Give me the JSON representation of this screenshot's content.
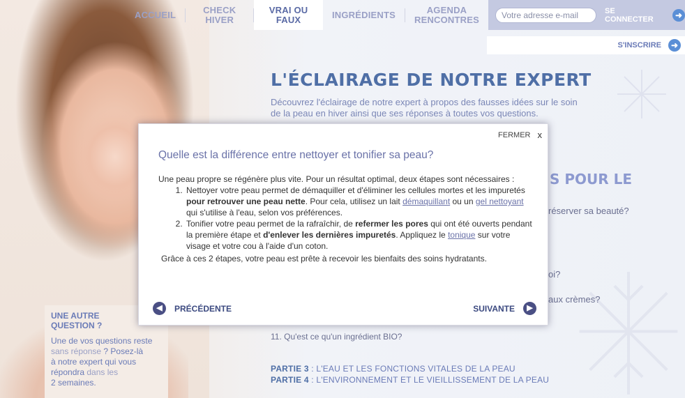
{
  "nav": {
    "items": [
      "ACCUEIL",
      "CHECK HIVER",
      "VRAI OU",
      "FAUX",
      "INGRÉDIENTS",
      "AGENDA",
      "RENCONTRES"
    ]
  },
  "login": {
    "email_placeholder": "Votre adresse e-mail",
    "connect_label": "SE CONNECTER",
    "register_label": "S'INSCRIRE"
  },
  "main": {
    "title": "L'ÉCLAIRAGE DE NOTRE EXPERT",
    "intro": "Découvrez l'éclairage de notre expert à propos des fausses idées sur le soin de la peau en hiver ainsi que ses réponses à toutes vos questions.",
    "bg_heading": "S POUR LE",
    "bg_q1": "réserver sa beauté?",
    "bg_q2": "oi?",
    "bg_q3": "aux crèmes?",
    "q11": "11.  Qu'est ce qu'un ingrédient BIO?",
    "part3_label": "PARTIE 3",
    "part3_text": " : L'EAU ET LES FONCTIONS VITALES DE LA PEAU",
    "part4_label": "PARTIE 4",
    "part4_text": " : L'ENVIRONNEMENT ET LE VIEILLISSEMENT DE LA PEAU"
  },
  "side": {
    "title_1": "UNE AUTRE",
    "title_2": "QUESTION ?",
    "t1": "Une de vos questions reste",
    "t2a": "sans réponse",
    "t2b": " ? Posez-là",
    "t3": "à notre expert qui vous",
    "t4a": "répondra",
    "t4b": " dans les",
    "t5": "2 semaines."
  },
  "modal": {
    "close_label": "FERMER",
    "close_x": "x",
    "question": "Quelle est la différence entre nettoyer et tonifier sa peau?",
    "intro": "Une peau propre se régénère plus vite. Pour un résultat optimal, deux étapes sont nécessaires :",
    "item1_a": "Nettoyer votre peau permet de démaquiller et d'éliminer les cellules mortes et les impuretés ",
    "item1_b": "pour retrouver une peau nette",
    "item1_c": ". Pour cela, utilisez un lait ",
    "item1_link1": "démaquillant",
    "item1_d": " ou un ",
    "item1_link2": "gel nettoyant",
    "item1_e": " qui s'utilise à l'eau, selon vos préférences.",
    "item2_a": "Tonifier votre peau permet de la rafraîchir, de ",
    "item2_b": "refermer les pores",
    "item2_c": " qui ont été ouverts pendant la première étape et ",
    "item2_d": "d'enlever les dernières impuretés",
    "item2_e": ". Appliquez le ",
    "item2_link": "tonique",
    "item2_f": " sur votre visage et votre cou à l'aide d'un coton.",
    "final": "Grâce à ces 2 étapes, votre peau est prête à recevoir les bienfaits des soins hydratants.",
    "prev_label": "PRÉCÉDENTE",
    "next_label": "SUIVANTE"
  },
  "icons": {
    "arrow_right": "➜",
    "arrow_left": "◀",
    "arrow_next": "▶"
  },
  "colors": {
    "accent": "#4f6fa6",
    "nav_bg": "#c4c9e1",
    "button_circle": "#4a4f84"
  }
}
